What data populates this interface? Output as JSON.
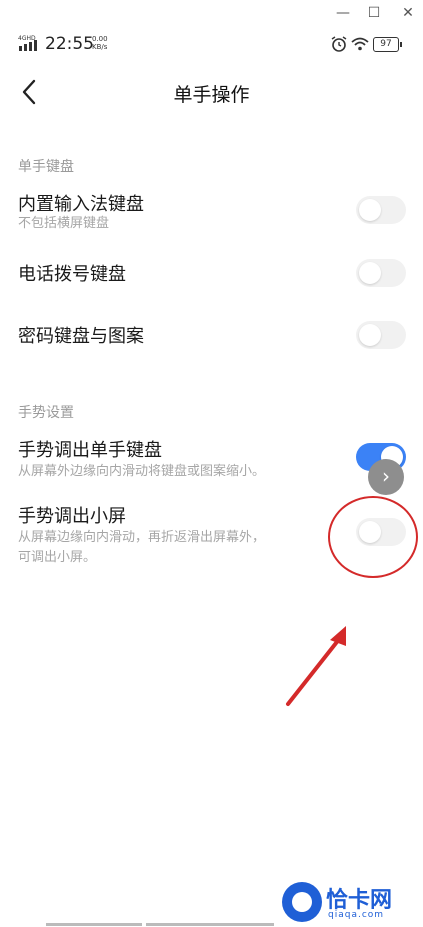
{
  "window": {
    "minimize": "—",
    "maximize": "☐",
    "close": "✕"
  },
  "status_bar": {
    "network": "4GHD",
    "time": "22:55",
    "speed": "0.00",
    "speed_unit": "KB/s",
    "battery": "97"
  },
  "header": {
    "title": "单手操作"
  },
  "sections": [
    {
      "label": "单手键盘",
      "items": [
        {
          "title": "内置输入法键盘",
          "subtitle": "不包括横屏键盘",
          "enabled": false
        },
        {
          "title": "电话拨号键盘",
          "enabled": false
        },
        {
          "title": "密码键盘与图案",
          "enabled": false
        }
      ]
    },
    {
      "label": "手势设置",
      "items": [
        {
          "title": "手势调出单手键盘",
          "subtitle": "从屏幕外边缘向内滑动将键盘或图案缩小。",
          "enabled": true
        },
        {
          "title": "手势调出小屏",
          "subtitle_line1": "从屏幕边缘向内滑动，再折返滑出屏幕外，",
          "subtitle_line2": "可调出小屏。",
          "enabled": false
        }
      ]
    }
  ],
  "watermark": {
    "text": "恰卡网",
    "sub": "qiaqa.com"
  },
  "colors": {
    "accent": "#3b82f6",
    "annotation": "#d42a2a"
  }
}
